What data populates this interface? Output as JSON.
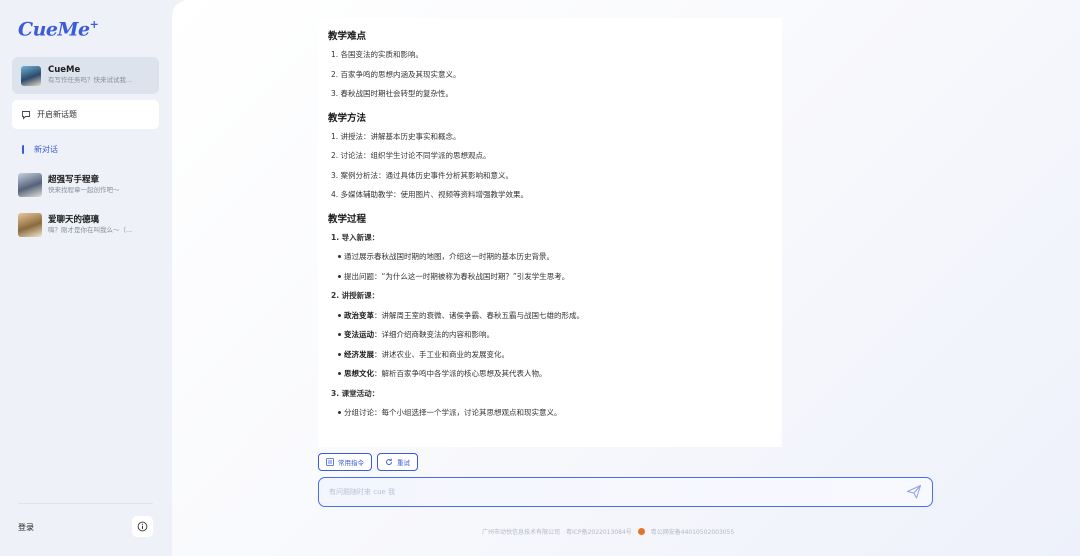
{
  "sidebar": {
    "logo": "CueMe",
    "logo_mark": "+",
    "current_chat": {
      "name": "CueMe",
      "subtitle": "有写作任务吗？快来试试我..."
    },
    "new_topic_label": "开启新话题",
    "new_chat_label": "新对话",
    "agents": [
      {
        "name": "超强写手程章",
        "subtitle": "快来找程章一起创作吧～"
      },
      {
        "name": "爱聊天的德璃",
        "subtitle": "嗨？刚才是你在叫我么～（..."
      }
    ],
    "login_label": "登录",
    "info_icon": "info-icon"
  },
  "content": {
    "difficulty_title": "教学难点",
    "difficulty_items": [
      "1. 各国变法的实质和影响。",
      "2. 百家争鸣的思想内涵及其现实意义。",
      "3. 春秋战国时期社会转型的复杂性。"
    ],
    "method_title": "教学方法",
    "method_items": [
      "1. 讲授法：讲解基本历史事实和概念。",
      "2. 讨论法：组织学生讨论不同学派的思想观点。",
      "3. 案例分析法：通过具体历史事件分析其影响和意义。",
      "4. 多媒体辅助教学：使用图片、视频等资料增强教学效果。"
    ],
    "process_title": "教学过程",
    "step1_title": "1. 导入新课：",
    "step1_bullets": [
      "通过展示春秋战国时期的地图，介绍这一时期的基本历史背景。",
      "提出问题：“为什么这一时期被称为春秋战国时期？”引发学生思考。"
    ],
    "step2_title": "2. 讲授新课：",
    "step2_bullets": [
      {
        "label": "政治变革",
        "text": "：讲解周王室的衰微、诸侯争霸、春秋五霸与战国七雄的形成。"
      },
      {
        "label": "变法运动",
        "text": "：详细介绍商鞅变法的内容和影响。"
      },
      {
        "label": "经济发展",
        "text": "：讲述农业、手工业和商业的发展变化。"
      },
      {
        "label": "思想文化",
        "text": "：解析百家争鸣中各学派的核心思想及其代表人物。"
      }
    ],
    "step3_title": "3. 课堂活动：",
    "step3_bullets": [
      "分组讨论：每个小组选择一个学派，讨论其思想观点和现实意义。"
    ]
  },
  "actions": {
    "commands_label": "常用指令",
    "retry_label": "重试"
  },
  "input": {
    "placeholder": "有问题随时来 cue 我"
  },
  "footer": {
    "company": "广州市动悦信息技术有限公司",
    "icp": "粤ICP备2022013084号",
    "police": "粤公网安备44010502003055"
  },
  "colors": {
    "accent": "#3b5bdb",
    "sidebar_bg": "#eef1f7"
  }
}
